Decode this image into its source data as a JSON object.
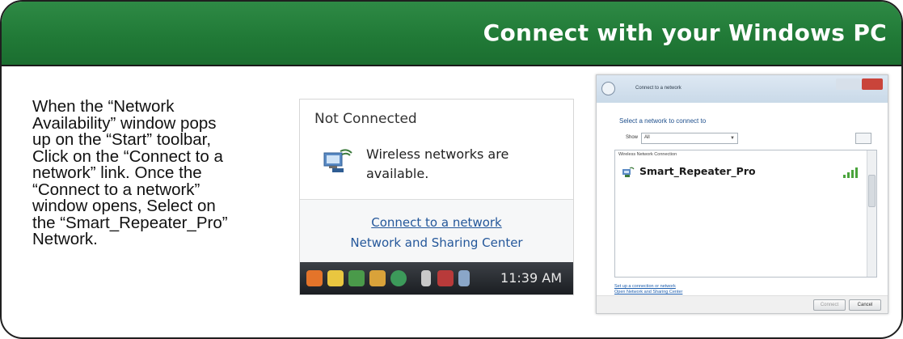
{
  "header": {
    "title": "Connect with your Windows PC"
  },
  "instructions": {
    "text": " When the “Network\nAvailability” window pops\nup on the “Start” toolbar,\nClick on the “Connect to a\nnetwork” link. Once the\n“Connect to a network”\nwindow opens, Select on\nthe “Smart_Repeater_Pro”\nNetwork."
  },
  "popup": {
    "status": "Not Connected",
    "message": "Wireless networks are available.",
    "link_connect": "Connect to a network",
    "link_sharing": "Network and Sharing Center",
    "taskbar_time": "11:39 AM"
  },
  "window": {
    "title": "Connect to a network",
    "heading": "Select a network to connect to",
    "show_label": "Show",
    "show_value": "All",
    "list_header": "Wireless Network Connection",
    "network_name": "Smart_Repeater_Pro",
    "link_setup": "Set up a connection or network",
    "link_open": "Open Network and Sharing Center",
    "btn_connect": "Connect",
    "btn_cancel": "Cancel"
  },
  "colors": {
    "header_green": "#217a37",
    "link_blue": "#24579a"
  }
}
